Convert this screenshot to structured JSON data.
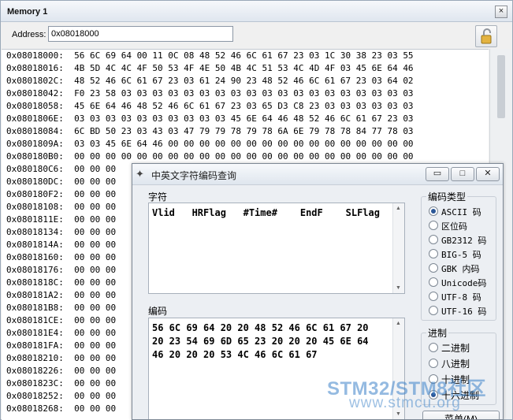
{
  "memory_window": {
    "title": "Memory 1",
    "close_glyph": "×",
    "address_label": "Address:",
    "address_value": "0x08018000",
    "lock_icon": "padlock-open-icon",
    "rows": [
      "0x08018000:  56 6C 69 64 00 11 0C 08 48 52 46 6C 61 67 23 03 1C 30 38 23 03 55",
      "0x08018016:  4B 5D 4C 4C 4F 50 53 4F 4E 50 4B 4C 51 53 4C 4D 4F 03 45 6E 64 46",
      "0x0801802C:  48 52 46 6C 61 67 23 03 61 24 90 23 48 52 46 6C 61 67 23 03 64 02",
      "0x08018042:  F0 23 58 03 03 03 03 03 03 03 03 03 03 03 03 03 03 03 03 03 03 03",
      "0x08018058:  45 6E 64 46 48 52 46 6C 61 67 23 03 65 D3 C8 23 03 03 03 03 03 03",
      "0x0801806E:  03 03 03 03 03 03 03 03 03 03 45 6E 64 46 48 52 46 6C 61 67 23 03",
      "0x08018084:  6C BD 50 23 03 43 03 47 79 79 78 79 78 6A 6E 79 78 78 84 77 78 03",
      "0x0801809A:  03 03 45 6E 64 46 00 00 00 00 00 00 00 00 00 00 00 00 00 00 00 00",
      "0x080180B0:  00 00 00 00 00 00 00 00 00 00 00 00 00 00 00 00 00 00 00 00 00 00",
      "0x080180C6:  00 00 00",
      "0x080180DC:  00 00 00",
      "0x080180F2:  00 00 00",
      "0x08018108:  00 00 00",
      "0x0801811E:  00 00 00",
      "0x08018134:  00 00 00",
      "0x0801814A:  00 00 00",
      "0x08018160:  00 00 00",
      "0x08018176:  00 00 00",
      "0x0801818C:  00 00 00",
      "0x080181A2:  00 00 00",
      "0x080181B8:  00 00 00",
      "0x080181CE:  00 00 00",
      "0x080181E4:  00 00 00",
      "0x080181FA:  00 00 00",
      "0x08018210:  00 00 00",
      "0x08018226:  00 00 00",
      "0x0801823C:  00 00 00",
      "0x08018252:  00 00 00",
      "0x08018268:  00 00 00"
    ]
  },
  "dialog": {
    "title": "中英文字符编码查询",
    "app_icon": "wand-icon",
    "min_glyph": "▭",
    "max_glyph": "□",
    "close_glyph": "✕",
    "chars_label": "字符",
    "chars_text": "Vlid   HRFlag   #Time#    EndF    SLFlag",
    "code_label": "编码",
    "code_text": "56 6C 69 64 20 20 48 52 46 6C 61 67 20\n20 23 54 69 6D 65 23 20 20 20 45 6E 64\n46 20 20 20 53 4C 46 6C 61 67",
    "encoding_group": {
      "title": "编码类型",
      "options": [
        "ASCII 码",
        "区位码",
        "GB2312 码",
        "BIG-5 码",
        "GBK 内码",
        "Unicode码",
        "UTF-8 码",
        "UTF-16 码"
      ],
      "selected_index": 0
    },
    "radix_group": {
      "title": "进制",
      "options": [
        "二进制",
        "八进制",
        "十进制",
        "十六进制"
      ],
      "selected_index": 3
    },
    "menu_button": "菜单(M)"
  },
  "watermark": {
    "line1": "STM32/STM8社区",
    "line2": "www.stmcu.org"
  },
  "colors": {
    "title_gradient_top": "#f6f8fb",
    "title_gradient_bottom": "#dfe6ef",
    "radio_selected": "#2b5797",
    "watermark": "#3c82c8"
  }
}
